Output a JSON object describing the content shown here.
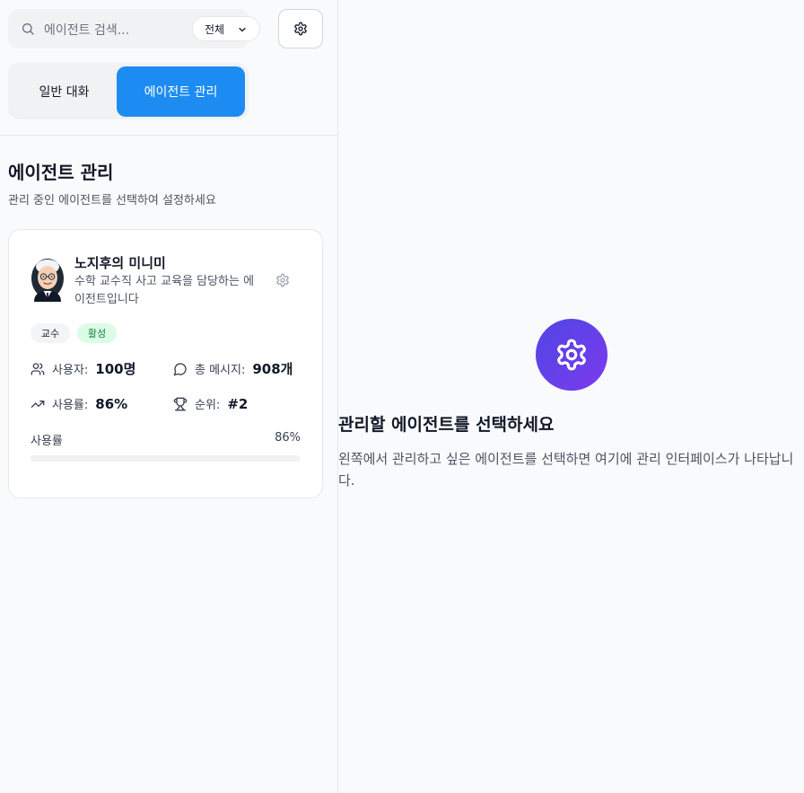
{
  "search": {
    "placeholder": "에이전트 검색..."
  },
  "filter": {
    "selected": "전체"
  },
  "tabs": [
    {
      "label": "일반 대화",
      "active": false
    },
    {
      "label": "에이전트 관리",
      "active": true
    }
  ],
  "section": {
    "title": "에이전트 관리",
    "subtitle": "관리 중인 에이전트를 선택하여 설정하세요"
  },
  "agent": {
    "name": "노지후의 미니미",
    "description": "수학 교수직 사고 교육을 담당하는 에이전트입니다",
    "role_badge": "교수",
    "status_badge": "활성",
    "stats": {
      "users_label": "사용자:",
      "users_value": "100명",
      "messages_label": "총 메시지:",
      "messages_value": "908개",
      "usage_label": "사용률:",
      "usage_value": "86%",
      "rank_label": "순위:",
      "rank_value": "#2"
    },
    "usage_bar": {
      "label": "사용률",
      "percent_text": "86%",
      "value": 86
    }
  },
  "empty_state": {
    "title": "관리할 에이전트를 선택하세요",
    "description": "왼쪽에서 관리하고 싶은 에이전트를 선택하면 여기에 관리 인터페이스가 나타납니다."
  },
  "colors": {
    "accent": "#1d8cf2",
    "gradient_start": "#4f46e5",
    "gradient_end": "#7c3aed",
    "status_active_bg": "#dcfce7",
    "status_active_text": "#15803d"
  }
}
